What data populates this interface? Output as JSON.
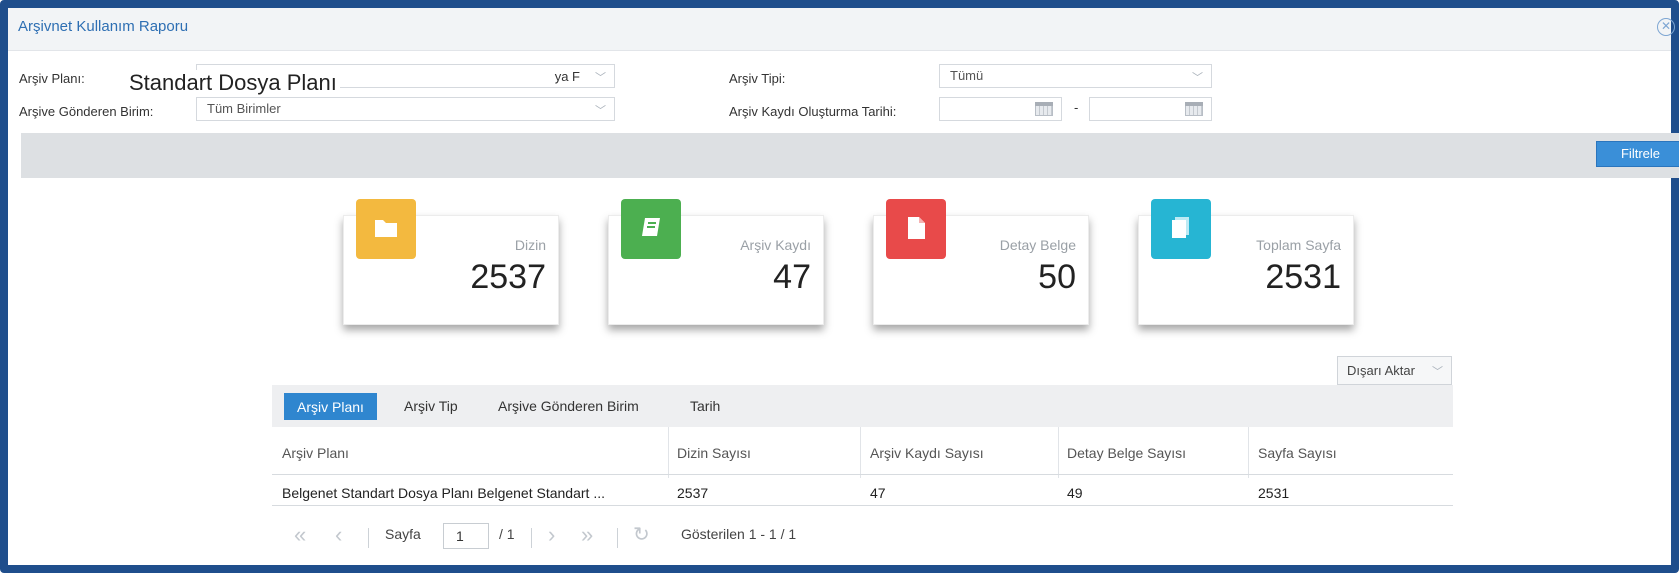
{
  "window": {
    "title": "Arşivnet Kullanım Raporu"
  },
  "filters": {
    "plan_label": "Arşiv Planı:",
    "plan_value_fragment": "ya F",
    "plan_overlay": "Standart Dosya Planı",
    "unit_label": "Arşive Gönderen Birim:",
    "unit_value": "Tüm Birimler",
    "type_label": "Arşiv Tipi:",
    "type_value": "Tümü",
    "date_label": "Arşiv Kaydı Oluşturma Tarihi:",
    "date_separator": "-",
    "filter_button": "Filtrele"
  },
  "cards": [
    {
      "label": "Dizin",
      "value": "2537",
      "color": "#f3b93f",
      "icon": "folder-icon"
    },
    {
      "label": "Arşiv Kaydı",
      "value": "47",
      "color": "#4caf50",
      "icon": "book-icon"
    },
    {
      "label": "Detay Belge",
      "value": "50",
      "color": "#e84a4a",
      "icon": "document-icon"
    },
    {
      "label": "Toplam Sayfa",
      "value": "2531",
      "color": "#26b5d3",
      "icon": "pages-icon"
    }
  ],
  "export_button": "Dışarı Aktar",
  "tabs": [
    "Arşiv Planı",
    "Arşiv Tip",
    "Arşive Gönderen Birim",
    "Tarih"
  ],
  "table": {
    "headers": [
      "Arşiv Planı",
      "Dizin Sayısı",
      "Arşiv Kaydı Sayısı",
      "Detay Belge Sayısı",
      "Sayfa Sayısı"
    ],
    "rows": [
      [
        "Belgenet Standart Dosya Planı Belgenet Standart ...",
        "2537",
        "47",
        "49",
        "2531"
      ]
    ]
  },
  "pager": {
    "page_label": "Sayfa",
    "page_value": "1",
    "total": "/ 1",
    "status": "Gösterilen 1 - 1 / 1"
  }
}
